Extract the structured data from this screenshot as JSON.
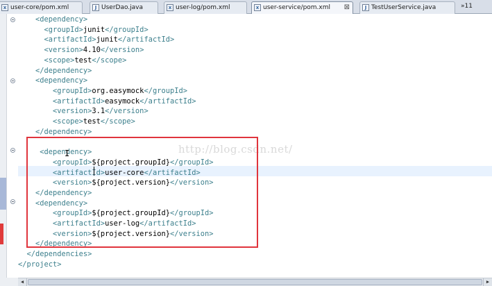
{
  "tabs": [
    {
      "label": "user-core/pom.xml",
      "icon": "xml-file-icon",
      "active": false
    },
    {
      "label": "UserDao.java",
      "icon": "java-file-icon",
      "active": false
    },
    {
      "label": "user-log/pom.xml",
      "icon": "xml-file-icon",
      "active": false
    },
    {
      "label": "user-service/pom.xml",
      "icon": "xml-file-icon",
      "active": true,
      "close": "⊠"
    },
    {
      "label": "TestUserService.java",
      "icon": "java-file-icon",
      "active": false
    }
  ],
  "overflow": {
    "label": "»11"
  },
  "watermark": "http://blog.csdn.net/",
  "code": [
    {
      "indent": "    ",
      "parts": [
        [
          "tag",
          "<dependency>"
        ]
      ]
    },
    {
      "indent": "      ",
      "parts": [
        [
          "tag",
          "<groupId>"
        ],
        [
          "txt",
          "junit"
        ],
        [
          "tag",
          "</groupId>"
        ]
      ]
    },
    {
      "indent": "      ",
      "parts": [
        [
          "tag",
          "<artifactId>"
        ],
        [
          "txt",
          "junit"
        ],
        [
          "tag",
          "</artifactId>"
        ]
      ]
    },
    {
      "indent": "      ",
      "parts": [
        [
          "tag",
          "<version>"
        ],
        [
          "txt",
          "4.10"
        ],
        [
          "tag",
          "</version>"
        ]
      ]
    },
    {
      "indent": "      ",
      "parts": [
        [
          "tag",
          "<scope>"
        ],
        [
          "txt",
          "test"
        ],
        [
          "tag",
          "</scope>"
        ]
      ]
    },
    {
      "indent": "    ",
      "parts": [
        [
          "tag",
          "</dependency>"
        ]
      ]
    },
    {
      "indent": "    ",
      "parts": [
        [
          "tag",
          "<dependency>"
        ]
      ]
    },
    {
      "indent": "        ",
      "parts": [
        [
          "tag",
          "<groupId>"
        ],
        [
          "txt",
          "org.easymock"
        ],
        [
          "tag",
          "</groupId>"
        ]
      ]
    },
    {
      "indent": "        ",
      "parts": [
        [
          "tag",
          "<artifactId>"
        ],
        [
          "txt",
          "easymock"
        ],
        [
          "tag",
          "</artifactId>"
        ]
      ]
    },
    {
      "indent": "        ",
      "parts": [
        [
          "tag",
          "<version>"
        ],
        [
          "txt",
          "3.1"
        ],
        [
          "tag",
          "</version>"
        ]
      ]
    },
    {
      "indent": "        ",
      "parts": [
        [
          "tag",
          "<scope>"
        ],
        [
          "txt",
          "test"
        ],
        [
          "tag",
          "</scope>"
        ]
      ]
    },
    {
      "indent": "    ",
      "parts": [
        [
          "tag",
          "</dependency>"
        ]
      ]
    },
    {
      "indent": "",
      "parts": []
    },
    {
      "indent": "     ",
      "parts": [
        [
          "tag",
          "<dependency>"
        ]
      ]
    },
    {
      "indent": "        ",
      "parts": [
        [
          "tag",
          "<groupId>"
        ],
        [
          "txt",
          "${project.groupId}"
        ],
        [
          "tag",
          "</groupId>"
        ]
      ]
    },
    {
      "indent": "        ",
      "parts": [
        [
          "tag",
          "<artifactId>"
        ],
        [
          "txt",
          "user-core"
        ],
        [
          "tag",
          "</artifactId>"
        ]
      ]
    },
    {
      "indent": "        ",
      "parts": [
        [
          "tag",
          "<version>"
        ],
        [
          "txt",
          "${project.version}"
        ],
        [
          "tag",
          "</version>"
        ]
      ]
    },
    {
      "indent": "    ",
      "parts": [
        [
          "tag",
          "</dependency>"
        ]
      ]
    },
    {
      "indent": "    ",
      "parts": [
        [
          "tag",
          "<dependency>"
        ]
      ]
    },
    {
      "indent": "        ",
      "parts": [
        [
          "tag",
          "<groupId>"
        ],
        [
          "txt",
          "${project.groupId}"
        ],
        [
          "tag",
          "</groupId>"
        ]
      ]
    },
    {
      "indent": "        ",
      "parts": [
        [
          "tag",
          "<artifactId>"
        ],
        [
          "txt",
          "user-log"
        ],
        [
          "tag",
          "</artifactId>"
        ]
      ]
    },
    {
      "indent": "        ",
      "parts": [
        [
          "tag",
          "<version>"
        ],
        [
          "txt",
          "${project.version}"
        ],
        [
          "tag",
          "</version>"
        ]
      ]
    },
    {
      "indent": "    ",
      "parts": [
        [
          "tag",
          "</dependency>"
        ]
      ]
    },
    {
      "indent": "  ",
      "parts": [
        [
          "tag",
          "</dependencies>"
        ]
      ]
    },
    {
      "indent": "",
      "parts": [
        [
          "tag",
          "</project>"
        ]
      ]
    }
  ],
  "colors": {
    "tag": "#3c7f8c",
    "text": "#000000",
    "highlight_box": "#e0343c"
  }
}
